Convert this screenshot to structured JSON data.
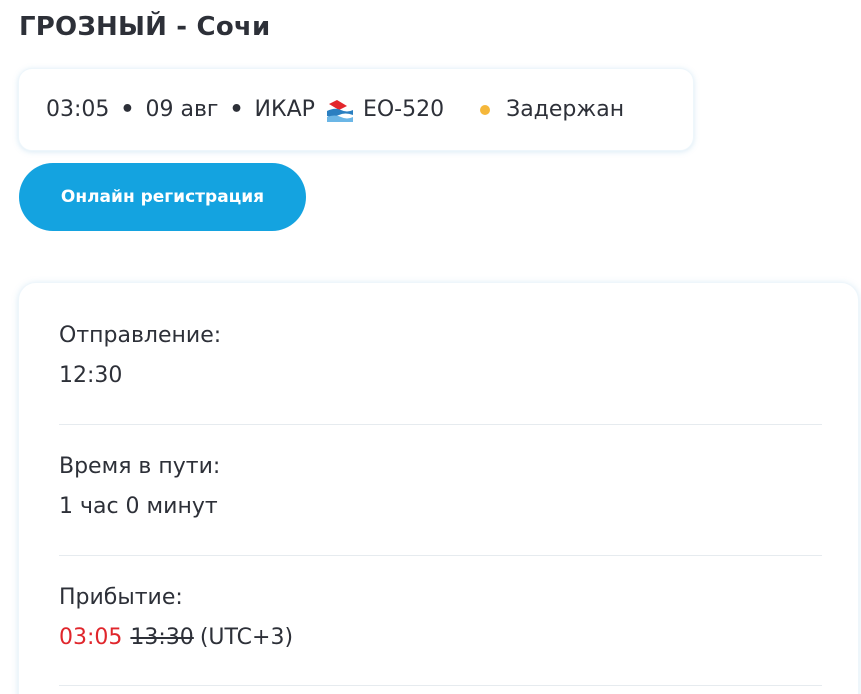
{
  "header": {
    "route": "ГРОЗНЫЙ - Сочи"
  },
  "flight": {
    "time": "03:05",
    "date": "09 авг",
    "airline": "ИКАР",
    "airline_logo_icon": "ikar-airline-logo-icon",
    "flight_number": "ЕО-520",
    "status": "Задержан",
    "separator": "•",
    "status_color": "#f5b73a"
  },
  "actions": {
    "checkin_label": "Онлайн регистрация",
    "accent_color": "#14a3e0"
  },
  "details": {
    "departure_label": "Отправление:",
    "departure_value": "12:30",
    "duration_label": "Время в пути:",
    "duration_value": "1 час 0 минут",
    "arrival_label": "Прибытие:",
    "arrival_new_time": "03:05",
    "arrival_old_time": "13:30",
    "arrival_timezone": "(UTC+3)",
    "delay_color": "#e0262c"
  }
}
